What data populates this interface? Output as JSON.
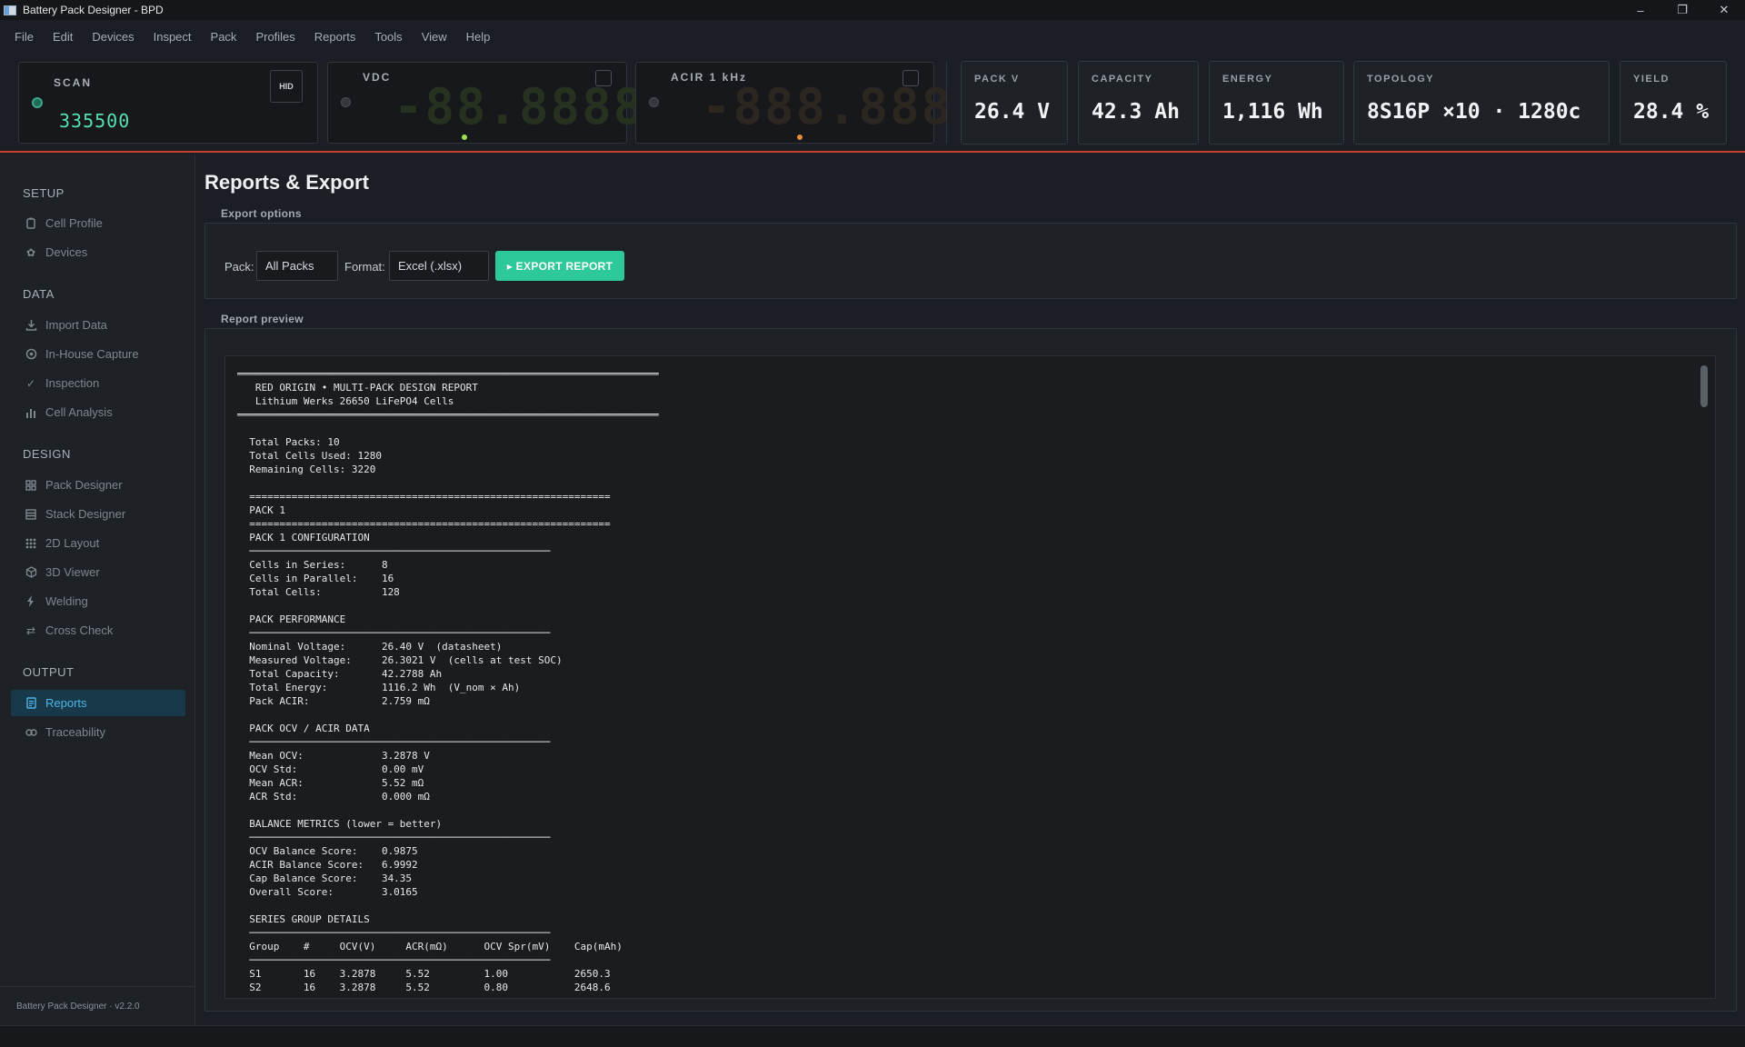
{
  "window": {
    "title": "Battery Pack Designer - BPD",
    "controls": [
      "–",
      "❐",
      "✕"
    ]
  },
  "menu": [
    "File",
    "Edit",
    "Devices",
    "Inspect",
    "Pack",
    "Profiles",
    "Reports",
    "Tools",
    "View",
    "Help"
  ],
  "instruments": {
    "scan": {
      "label": "SCAN",
      "value": "335500",
      "hid_label": "HID"
    },
    "vdc": {
      "label": "VDC",
      "display": "-88.8888"
    },
    "acir": {
      "label": "ACIR  1 kHz",
      "display": "-888.888"
    }
  },
  "stats": [
    {
      "label": "PACK V",
      "value": "26.4 V"
    },
    {
      "label": "CAPACITY",
      "value": "42.3 Ah"
    },
    {
      "label": "ENERGY",
      "value": "1,116 Wh"
    },
    {
      "label": "TOPOLOGY",
      "value": "8S16P ×10 · 1280c"
    },
    {
      "label": "YIELD",
      "value": "28.4 %"
    }
  ],
  "sidebar": {
    "sections": [
      "SETUP",
      "DATA",
      "DESIGN",
      "OUTPUT"
    ],
    "items": [
      {
        "label": "Cell Profile",
        "icon": "battery-icon"
      },
      {
        "label": "Devices",
        "icon": "gear-icon"
      },
      {
        "label": "Import Data",
        "icon": "download-icon"
      },
      {
        "label": "In-House Capture",
        "icon": "target-icon"
      },
      {
        "label": "Inspection",
        "icon": "check-icon"
      },
      {
        "label": "Cell Analysis",
        "icon": "bar-chart-icon"
      },
      {
        "label": "Pack Designer",
        "icon": "grid-icon"
      },
      {
        "label": "Stack Designer",
        "icon": "stack-icon"
      },
      {
        "label": "2D Layout",
        "icon": "layout-icon"
      },
      {
        "label": "3D Viewer",
        "icon": "cube-icon"
      },
      {
        "label": "Welding",
        "icon": "bolt-icon"
      },
      {
        "label": "Cross Check",
        "icon": "swap-icon"
      },
      {
        "label": "Reports",
        "icon": "document-icon",
        "active": true
      },
      {
        "label": "Traceability",
        "icon": "link-icon"
      }
    ],
    "footer": "Battery Pack Designer · v2.2.0"
  },
  "main": {
    "title": "Reports & Export",
    "export_group": "Export options",
    "pack_label": "Pack:",
    "pack_value": "All Packs",
    "format_label": "Format:",
    "format_value": "Excel (.xlsx)",
    "export_button": "▸ EXPORT REPORT",
    "preview_group": "Report preview",
    "report_lines": [
      "══════════════════════════════════════════════════════════════════════",
      "   RED ORIGIN • MULTI-PACK DESIGN REPORT",
      "   Lithium Werks 26650 LiFePO4 Cells",
      "══════════════════════════════════════════════════════════════════════",
      "",
      "  Total Packs: 10",
      "  Total Cells Used: 1280",
      "  Remaining Cells: 3220",
      "",
      "  ============================================================",
      "  PACK 1",
      "  ============================================================",
      "  PACK 1 CONFIGURATION",
      "  ──────────────────────────────────────────────────",
      "  Cells in Series:      8",
      "  Cells in Parallel:    16",
      "  Total Cells:          128",
      "",
      "  PACK PERFORMANCE",
      "  ──────────────────────────────────────────────────",
      "  Nominal Voltage:      26.40 V  (datasheet)",
      "  Measured Voltage:     26.3021 V  (cells at test SOC)",
      "  Total Capacity:       42.2788 Ah",
      "  Total Energy:         1116.2 Wh  (V_nom × Ah)",
      "  Pack ACIR:            2.759 mΩ",
      "",
      "  PACK OCV / ACIR DATA",
      "  ──────────────────────────────────────────────────",
      "  Mean OCV:             3.2878 V",
      "  OCV Std:              0.00 mV",
      "  Mean ACR:             5.52 mΩ",
      "  ACR Std:              0.000 mΩ",
      "",
      "  BALANCE METRICS (lower = better)",
      "  ──────────────────────────────────────────────────",
      "  OCV Balance Score:    0.9875",
      "  ACIR Balance Score:   6.9992",
      "  Cap Balance Score:    34.35",
      "  Overall Score:        3.0165",
      "",
      "  SERIES GROUP DETAILS",
      "  ──────────────────────────────────────────────────",
      "  Group    #     OCV(V)     ACR(mΩ)      OCV Spr(mV)    Cap(mAh)",
      "  ──────────────────────────────────────────────────",
      "  S1       16    3.2878     5.52         1.00           2650.3",
      "  S2       16    3.2878     5.52         0.80           2648.6"
    ]
  },
  "colors": {
    "accent": "#2ec99b",
    "active_nav": "#4fb4e6",
    "alert_line": "#c2412d"
  }
}
